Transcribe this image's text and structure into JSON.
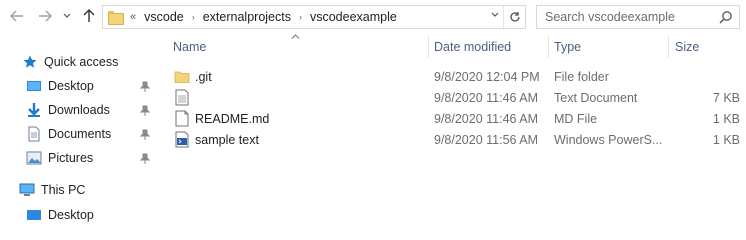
{
  "address": {
    "overflow": "«",
    "crumbs": [
      "vscode",
      "externalprojects",
      "vscodeexample"
    ]
  },
  "search": {
    "placeholder": "Search vscodeexample"
  },
  "sidebar": {
    "quick_access": "Quick access",
    "items": [
      {
        "label": "Desktop",
        "icon": "desktop-icon",
        "pinned": true
      },
      {
        "label": "Downloads",
        "icon": "downloads-icon",
        "pinned": true
      },
      {
        "label": "Documents",
        "icon": "documents-icon",
        "pinned": true
      },
      {
        "label": "Pictures",
        "icon": "pictures-icon",
        "pinned": true
      }
    ],
    "this_pc": "This PC",
    "partial_item": "Desktop"
  },
  "columns": {
    "name": "Name",
    "date": "Date modified",
    "type": "Type",
    "size": "Size"
  },
  "files": [
    {
      "name": ".git",
      "date": "9/8/2020 12:04 PM",
      "type": "File folder",
      "size": "",
      "icon": "folder-icon"
    },
    {
      "name": "",
      "date": "9/8/2020 11:46 AM",
      "type": "Text Document",
      "size": "7 KB",
      "icon": "text-document-icon"
    },
    {
      "name": "README.md",
      "date": "9/8/2020 11:46 AM",
      "type": "MD File",
      "size": "1 KB",
      "icon": "blank-file-icon"
    },
    {
      "name": "sample text",
      "date": "9/8/2020 11:56 AM",
      "type": "Windows PowerS...",
      "size": "1 KB",
      "icon": "powershell-file-icon"
    }
  ],
  "colors": {
    "header_text": "#4d6082",
    "folder_yellow": "#f4d27a",
    "quick_access_star": "#1e78d4"
  }
}
